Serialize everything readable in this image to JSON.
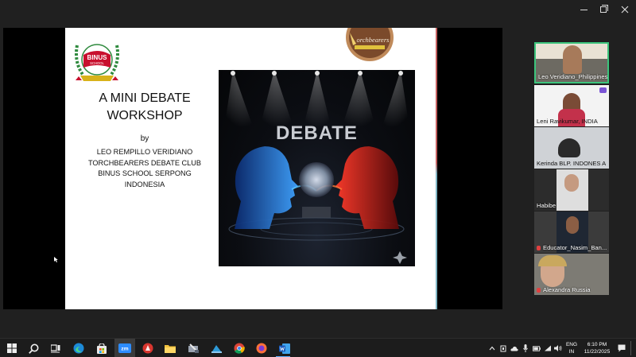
{
  "slide": {
    "title": "A MINI DEBATE\nWORKSHOP",
    "by": "by",
    "authors": [
      "LEO REMPILLO VERIDIANO",
      "TORCHBEARERS DEBATE CLUB",
      "BINUS SCHOOL SERPONG",
      "INDONESIA"
    ],
    "image_word": "DEBATE",
    "binus_logo_text": [
      "BINUS",
      "SCHOOL",
      "Serpong"
    ],
    "torch_logo_text": "orchbearers"
  },
  "participants": [
    {
      "name": "Leo Veridiano_Philippines",
      "muted": false,
      "bg": "#6a6a6a",
      "label_dark": false
    },
    {
      "name": "Leni Ravikumar, INDIA",
      "muted": false,
      "bg": "#f3f3f3",
      "label_dark": true
    },
    {
      "name": "Kerinda BLP. INDONES A",
      "muted": false,
      "bg": "#cfd2d6",
      "label_dark": true
    },
    {
      "name": "Habibe",
      "muted": false,
      "bg": "#2c2c2c",
      "label_dark": false
    },
    {
      "name": "Educator_Nasim_Ban...",
      "muted": true,
      "bg": "#3b3b3b",
      "label_dark": false
    },
    {
      "name": "Alexandra Russia",
      "muted": true,
      "bg": "#7d7b74",
      "label_dark": false
    }
  ],
  "taskbar": {
    "lang_line1": "ENG",
    "lang_line2": "IN",
    "time": "6:10 PM",
    "date": "11/22/2025",
    "zoom_label": "zm"
  },
  "colors": {
    "accent_green": "#3cc47c",
    "binus_green": "#2f8a3e",
    "binus_red": "#c8102e"
  }
}
